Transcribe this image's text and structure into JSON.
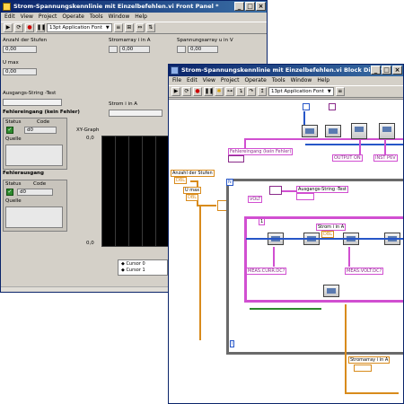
{
  "front_panel": {
    "title": "Strom-Spannungskennlinie mit Einzelbefehlen.vi Front Panel *",
    "menu": [
      "Edit",
      "View",
      "Project",
      "Operate",
      "Tools",
      "Window",
      "Help"
    ],
    "font": "13pt Application Font",
    "anzahl_label": "Anzahl der Stufen",
    "anzahl_value": "0,00",
    "umax_label": "U max",
    "umax_value": "0,00",
    "ausgang_label": "Ausgangs-String -Test",
    "fehlereingang_label": "Fehlereingang (kein Fehler)",
    "fehlerausgang_label": "Fehlerausgang",
    "status_label": "Status",
    "code_label": "Code",
    "code_value": "d0",
    "quelle_label": "Quelle",
    "stromarray_label": "Stromarray i in A",
    "spannungsarray_label": "Spannungsarray u in V",
    "strom_label": "Strom i in A",
    "graph_label": "XY-Graph",
    "y_tick_top": "0,0",
    "y_tick_bottom": "0,0",
    "array_values": [
      "0,00",
      "0,00",
      "0,00"
    ],
    "legend": [
      "Cursor 0",
      "Cursor 1"
    ],
    "check_mark": "✓",
    "win_buttons": [
      "_",
      "□",
      "×"
    ]
  },
  "block_diagram": {
    "title": "Strom-Spannungskennlinie mit Einzelbefehlen.vi Block Diagram *",
    "menu": [
      "File",
      "Edit",
      "View",
      "Project",
      "Operate",
      "Tools",
      "Window",
      "Help"
    ],
    "font": "13pt Application Font",
    "fehlereingang_label": "Fehlereingang (kein Fehler)",
    "output_on": "OUTPUT ON",
    "inst_pre": "INST P6V",
    "anzahl_label": "Anzahl der Stufen",
    "umax_label": "U max",
    "ausgang_label": "Ausgangs-String -Test",
    "volt_const": "VOLT",
    "strom_label": "Strom i in A",
    "meas_curr": "MEAS:CURR:DC?",
    "meas_volt": "MEAS:VOLT:DC?",
    "stromarray_label": "Stromarray i in A",
    "frame_number": "1",
    "i_label": "i",
    "n_label": "N",
    "dbl": "DBL",
    "win_buttons": [
      "_",
      "□",
      "×"
    ]
  }
}
